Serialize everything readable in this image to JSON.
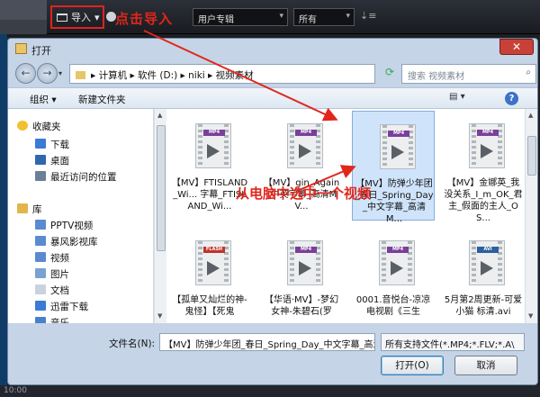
{
  "app": {
    "import_label": "导入",
    "album_select": "用户专辑",
    "all_select": "所有",
    "bottom_text": "10:00"
  },
  "annotations": {
    "click_import": "点击导入",
    "choose_video": "从电脑中选中一个视频"
  },
  "dialog": {
    "title": "打开",
    "breadcrumb": "▸ 计算机 ▸ 软件 (D:) ▸ niki ▸ 视频素材",
    "search_placeholder": "搜索 视频素材",
    "organize_label": "组织 ▾",
    "new_folder_label": "新建文件夹",
    "nav": {
      "favorites_header": "收藏夹",
      "favorites": [
        "下载",
        "桌面",
        "最近访问的位置"
      ],
      "libraries_header": "库",
      "libraries": [
        "PPTV视频",
        "暴风影视库",
        "视频",
        "图片",
        "文档",
        "迅雷下载",
        "音乐"
      ]
    },
    "files": [
      {
        "badge": "MP4",
        "name": "【MV】FTISLAND_Wi... 字幕_FTISLAND_Wi..."
      },
      {
        "badge": "MP4",
        "name": "【MV】gin_Again_中英字幕_高清MV..."
      },
      {
        "badge": "MP4",
        "name": "【MV】防弹少年团_春日_Spring_Day_中文字幕_高清M...",
        "selected": true
      },
      {
        "badge": "MP4",
        "name": "【MV】金娜英_我没关系_I_m_OK_君主_假面的主人_OS..."
      },
      {
        "badge": "FLASH",
        "name": "【孤单又灿烂的神-鬼怪】【死鬼"
      },
      {
        "badge": "MP4",
        "name": "【华语·MV】-梦幻女神-朱碧石(罗"
      },
      {
        "badge": "MP4",
        "name": "0001.音悦台-凉凉 电视剧《三生"
      },
      {
        "badge": "AVI",
        "name": "5月第2周更新-可爱小猫 标清.avi"
      }
    ],
    "filename_label": "文件名(N):",
    "filename_value": "【MV】防弹少年团_春日_Spring_Day_中文字幕_高清",
    "filetype_value": "所有支持文件(*.MP4;*.FLV;*.A\\",
    "open_label": "打开(O)",
    "cancel_label": "取消"
  },
  "colors": {
    "annotation_red": "#e1261c",
    "mp4_badge": "#7a3f9a",
    "flash_badge": "#c0342c",
    "avi_badge": "#2c5f9e"
  }
}
